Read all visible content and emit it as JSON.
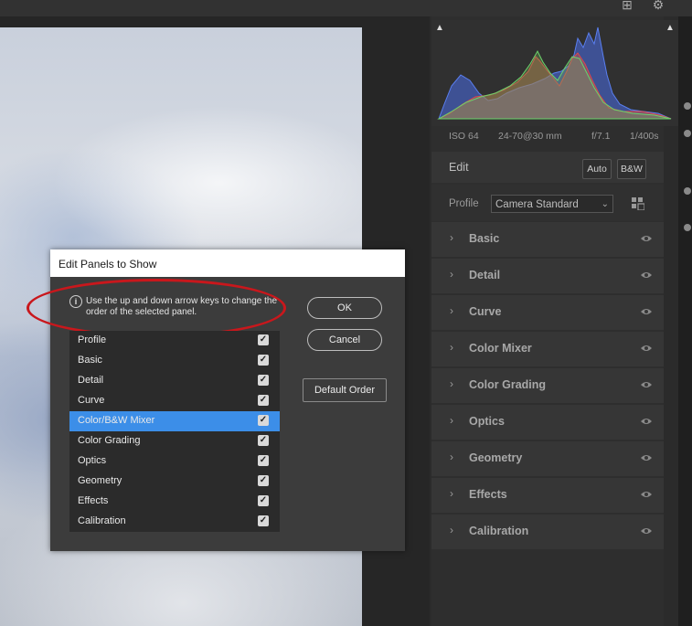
{
  "topbar": {
    "icons": [
      "add-image-icon",
      "gear-icon"
    ]
  },
  "histogram": {
    "shadow_clip_icon": "shadow-clipping-icon",
    "highlight_clip_icon": "highlight-clipping-icon",
    "meta": {
      "iso": "ISO 64",
      "lens": "24-70@30 mm",
      "aperture": "f/7.1",
      "shutter": "1/400s"
    }
  },
  "edit": {
    "title": "Edit",
    "auto_label": "Auto",
    "bw_label": "B&W",
    "profile_label": "Profile",
    "profile_value": "Camera Standard",
    "browse_icon": "grid-browse-icon"
  },
  "sections": [
    {
      "label": "Basic"
    },
    {
      "label": "Detail"
    },
    {
      "label": "Curve"
    },
    {
      "label": "Color Mixer"
    },
    {
      "label": "Color Grading"
    },
    {
      "label": "Optics"
    },
    {
      "label": "Geometry"
    },
    {
      "label": "Effects"
    },
    {
      "label": "Calibration"
    }
  ],
  "dialog": {
    "title": "Edit Panels to Show",
    "hint": "Use the up and down arrow keys to change the order of the selected panel.",
    "ok_label": "OK",
    "cancel_label": "Cancel",
    "default_order_label": "Default Order",
    "panels": [
      {
        "name": "Profile",
        "checked": true,
        "selected": false
      },
      {
        "name": "Basic",
        "checked": true,
        "selected": false
      },
      {
        "name": "Detail",
        "checked": true,
        "selected": false
      },
      {
        "name": "Curve",
        "checked": true,
        "selected": false
      },
      {
        "name": "Color/B&W Mixer",
        "checked": true,
        "selected": true
      },
      {
        "name": "Color Grading",
        "checked": true,
        "selected": false
      },
      {
        "name": "Optics",
        "checked": true,
        "selected": false
      },
      {
        "name": "Geometry",
        "checked": true,
        "selected": false
      },
      {
        "name": "Effects",
        "checked": true,
        "selected": false
      },
      {
        "name": "Calibration",
        "checked": true,
        "selected": false
      }
    ]
  },
  "colors": {
    "selection": "#3c8ee8",
    "annotation": "#c9171c",
    "hist_red": "#e04848",
    "hist_green": "#6bd46b",
    "hist_blue": "#4a6ee8"
  }
}
